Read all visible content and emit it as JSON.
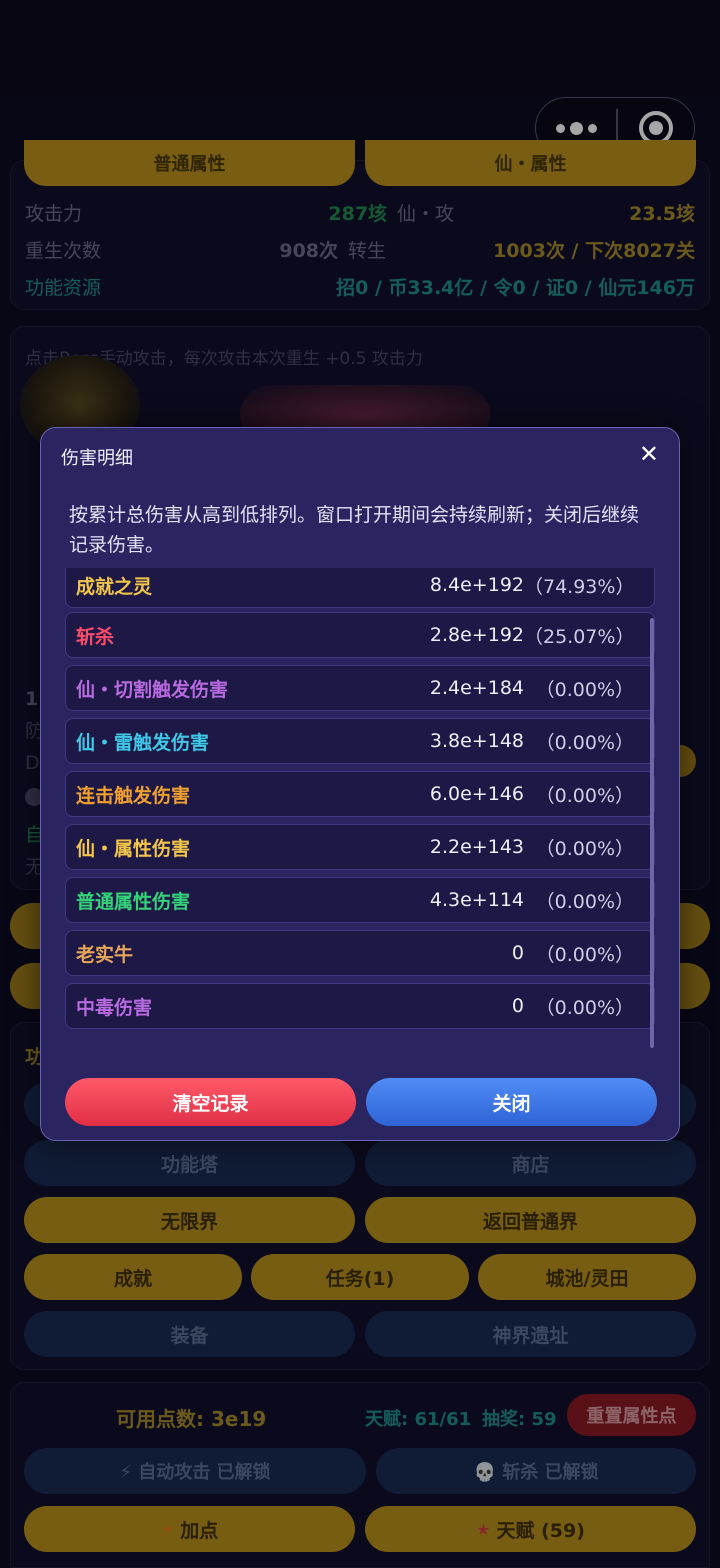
{
  "capsule": {
    "menu_icon": "more-dots-icon",
    "close_icon": "target-icon"
  },
  "bg": {
    "tab_left": "普通属性",
    "tab_right": "仙・属性",
    "row1": {
      "label": "攻击力",
      "value": "287垓",
      "label2": "仙・攻",
      "value2": "23.5垓"
    },
    "row2": {
      "label": "重生次数",
      "value": "908次",
      "label2": "转生",
      "value2": "1003次 / 下次8027关"
    },
    "row3": {
      "label": "功能资源",
      "value": "招0 / 币33.4亿 / 令0 / 证0 / 仙元146万"
    },
    "hint": "点击Boss手动攻击，每次攻击本次重生 +0.5 攻击力",
    "side_frag": [
      "1",
      "防",
      "D",
      "自",
      "无"
    ],
    "section_frag": "功",
    "buttons": {
      "tower": "功能塔",
      "shop": "商店",
      "infinite": "无限界",
      "return_normal": "返回普通界",
      "achievement": "成就",
      "task": "任务(1)",
      "city": "城池/灵田",
      "equip": "装备",
      "ruins": "神界遗址"
    },
    "points": "可用点数: 3e19",
    "talent_stat": "天赋: 61/61",
    "lottery_stat": "抽奖: 59",
    "reset_btn": "重置属性点",
    "auto_attack": "⚡ 自动攻击 已解锁",
    "kill": "💀 斩杀 已解锁",
    "add_point": "加点",
    "talent_btn": "天赋 (59)"
  },
  "modal": {
    "title": "伤害明细",
    "close": "✕",
    "desc": "按累计总伤害从高到低排列。窗口打开期间会持续刷新；关闭后继续记录伤害。",
    "items": [
      {
        "name": "成就之灵",
        "value": "8.4e+192",
        "pct": "（74.93%）",
        "color": "#f3c64a"
      },
      {
        "name": "斩杀",
        "value": "2.8e+192",
        "pct": "（25.07%）",
        "color": "#ff4d6a"
      },
      {
        "name": "仙・切割触发伤害",
        "value": "2.4e+184",
        "pct": "（0.00%）",
        "color": "#b86ae0"
      },
      {
        "name": "仙・雷触发伤害",
        "value": "3.8e+148",
        "pct": "（0.00%）",
        "color": "#3fc8e8"
      },
      {
        "name": "连击触发伤害",
        "value": "6.0e+146",
        "pct": "（0.00%）",
        "color": "#f0a030"
      },
      {
        "name": "仙・属性伤害",
        "value": "2.2e+143",
        "pct": "（0.00%）",
        "color": "#f3c64a"
      },
      {
        "name": "普通属性伤害",
        "value": "4.3e+114",
        "pct": "（0.00%）",
        "color": "#34d37a"
      },
      {
        "name": "老实牛",
        "value": "0",
        "pct": "（0.00%）",
        "color": "#e8a65a"
      },
      {
        "name": "中毒伤害",
        "value": "0",
        "pct": "（0.00%）",
        "color": "#b86ae0"
      }
    ],
    "clear_btn": "清空记录",
    "close_btn": "关闭"
  }
}
